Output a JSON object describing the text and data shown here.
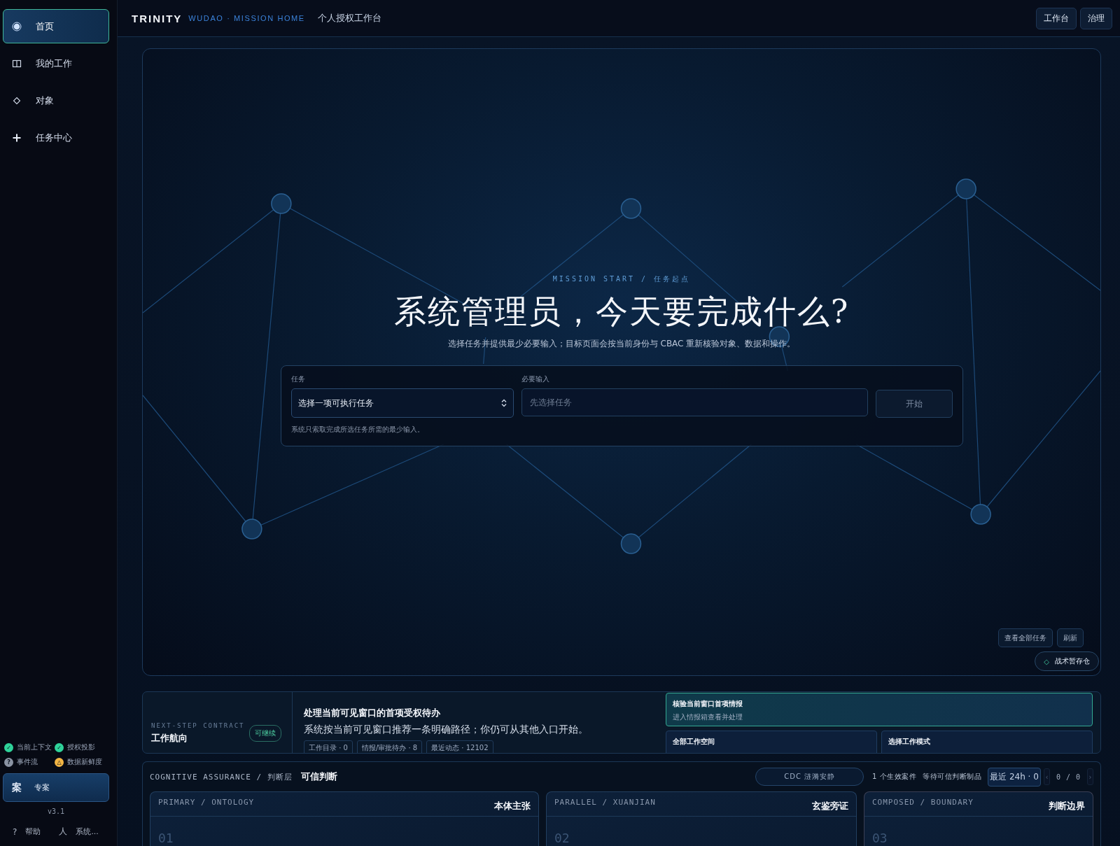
{
  "sidebar": {
    "items": [
      {
        "label": "首页",
        "kind": "radio",
        "selected": true
      },
      {
        "label": "我的工作",
        "kind": "columns",
        "selected": false
      },
      {
        "label": "对象",
        "kind": "diamond",
        "selected": false
      },
      {
        "label": "任务中心",
        "kind": "plus",
        "selected": false
      }
    ],
    "status": [
      {
        "label": "当前上下文",
        "symbol": "✓",
        "color": "#2fd39a"
      },
      {
        "label": "授权投影",
        "symbol": "✓",
        "color": "#2fd39a"
      },
      {
        "label": "事件流",
        "symbol": "?",
        "color": "#8a93a3"
      },
      {
        "label": "数据新鲜度",
        "symbol": "△",
        "color": "#f2b544"
      }
    ],
    "case_button": {
      "glyph": "案",
      "label": "专案"
    },
    "version": "v3.1",
    "footer": [
      {
        "symbol": "?",
        "label": "帮助"
      },
      {
        "symbol": "人",
        "label": "系统..."
      }
    ]
  },
  "header": {
    "brand": "TRINITY",
    "subtitle": "WUDAO · MISSION HOME",
    "page_title": "个人授权工作台",
    "buttons": [
      "工作台",
      "治理"
    ]
  },
  "hero": {
    "eyebrow": "MISSION START / 任务起点",
    "title": "系统管理员，今天要完成什么?",
    "description": "选择任务并提供最少必要输入；目标页面会按当前身份与 CBAC 重新核验对象、数据和操作。",
    "form": {
      "task_label": "任务",
      "task_value": "选择一项可执行任务",
      "input_label": "必要输入",
      "input_placeholder": "先选择任务",
      "start_button": "开始",
      "disabled": true,
      "hint": "系统只索取完成所选任务所需的最少输入。"
    },
    "corner_buttons": [
      "查看全部任务",
      "刷新"
    ],
    "stash_chip": {
      "symbol": "◇",
      "label": "战术暂存仓"
    }
  },
  "next_step": {
    "eyebrow": "NEXT-STEP CONTRACT",
    "title": "工作航向",
    "badge": "可继续",
    "headline": "处理当前可见窗口的首项受权待办",
    "description": "系统按当前可见窗口推荐一条明确路径；你仍可从其他入口开始。",
    "chips": [
      "工作目录 · 0",
      "情报/审批待办 · 8",
      "最近动态 · 12102"
    ],
    "actions": [
      {
        "title": "核验当前窗口首项情报",
        "subtitle": "进入情报箱查看并处理",
        "selected": true
      },
      {
        "title": "全部工作空间",
        "selected": false
      },
      {
        "title": "选择工作模式",
        "selected": false
      }
    ]
  },
  "assurance": {
    "eyebrow": "COGNITIVE ASSURANCE / 判断层",
    "title": "可信判断",
    "cdc_pill": "CDC 涟漪安静",
    "case_count": "1 个生效案件",
    "waiting": "等待可信判断制品",
    "range_select": "最近 24h · 0",
    "pager": {
      "prev": "‹",
      "value": "0 / 0",
      "next": "›"
    },
    "panels": [
      {
        "eyebrow": "PRIMARY / ONTOLOGY",
        "title": "本体主张",
        "number": "01"
      },
      {
        "eyebrow": "PARALLEL / XUANJIAN",
        "title": "玄鉴旁证",
        "number": "02"
      },
      {
        "eyebrow": "COMPOSED / BOUNDARY",
        "title": "判断边界",
        "number": "03"
      }
    ]
  }
}
